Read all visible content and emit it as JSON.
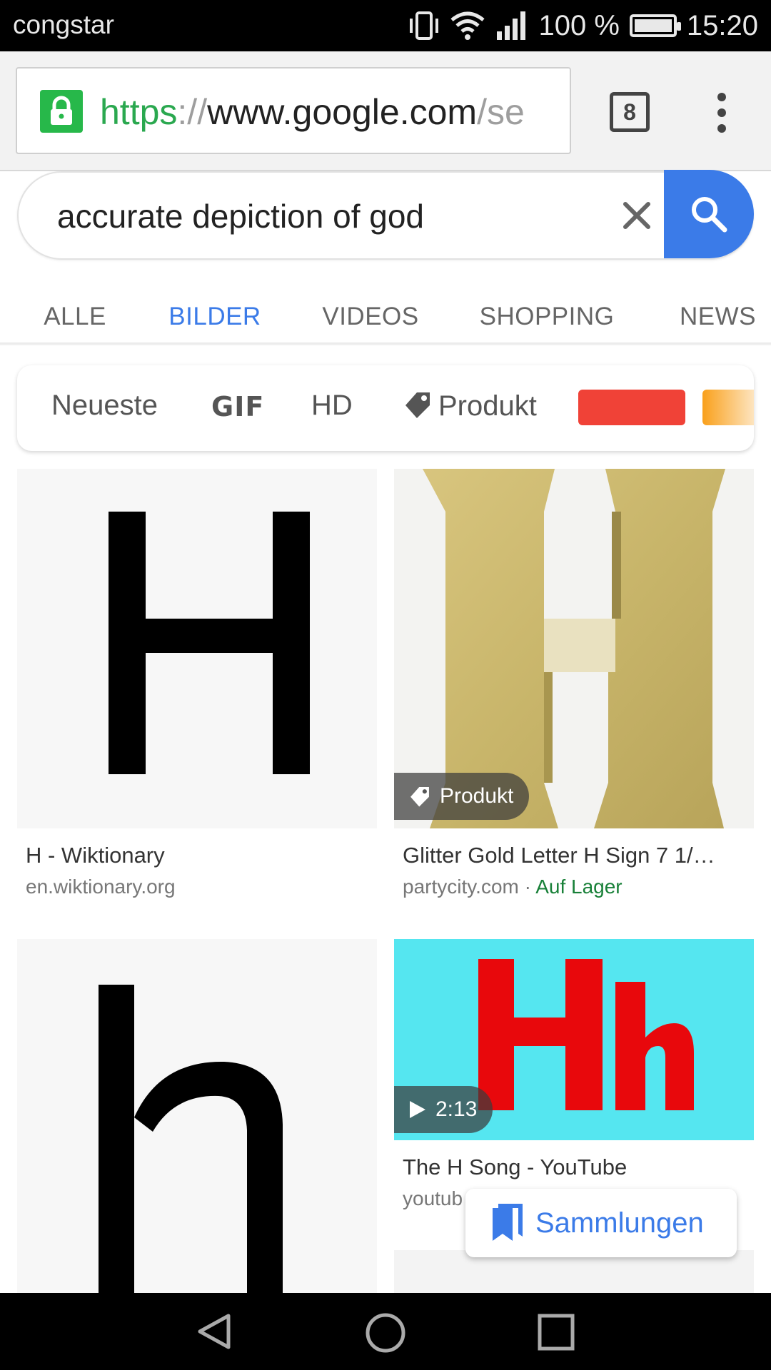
{
  "status_bar": {
    "carrier": "congstar",
    "battery": "100 %",
    "time": "15:20"
  },
  "browser": {
    "url_scheme": "https",
    "url_separator": "://",
    "url_host": "www.google.com",
    "url_path": "/se",
    "tab_count": "8"
  },
  "search": {
    "query": "accurate depiction of god"
  },
  "tabs": [
    {
      "label": "ALLE"
    },
    {
      "label": "BILDER"
    },
    {
      "label": "VIDEOS"
    },
    {
      "label": "SHOPPING"
    },
    {
      "label": "NEWS"
    }
  ],
  "chips": {
    "newest": "Neueste",
    "gif": "GIF",
    "hd": "HD",
    "product": "Produkt",
    "color_red": "#f04237",
    "color_orange": "#f9a01b"
  },
  "results": [
    {
      "title": "H - Wiktionary",
      "source": "en.wiktionary.org",
      "letter": "H"
    },
    {
      "title": "Glitter Gold Letter H Sign 7 1/…",
      "source": "partycity.com",
      "source_sep": " · ",
      "availability": "Auf Lager",
      "badge": "Produkt",
      "letter": "H"
    },
    {
      "title": "",
      "source": "",
      "letter": "h"
    },
    {
      "title": "The H Song - YouTube",
      "source": "youtub",
      "badge": "2:13",
      "letter": "Hh"
    }
  ],
  "collections_button": "Sammlungen",
  "colors": {
    "accent": "#3b7be8",
    "lock_green": "#27b84a",
    "in_stock_green": "#188038",
    "video_bg": "#55e6f0",
    "video_letters": "#e8080c"
  }
}
